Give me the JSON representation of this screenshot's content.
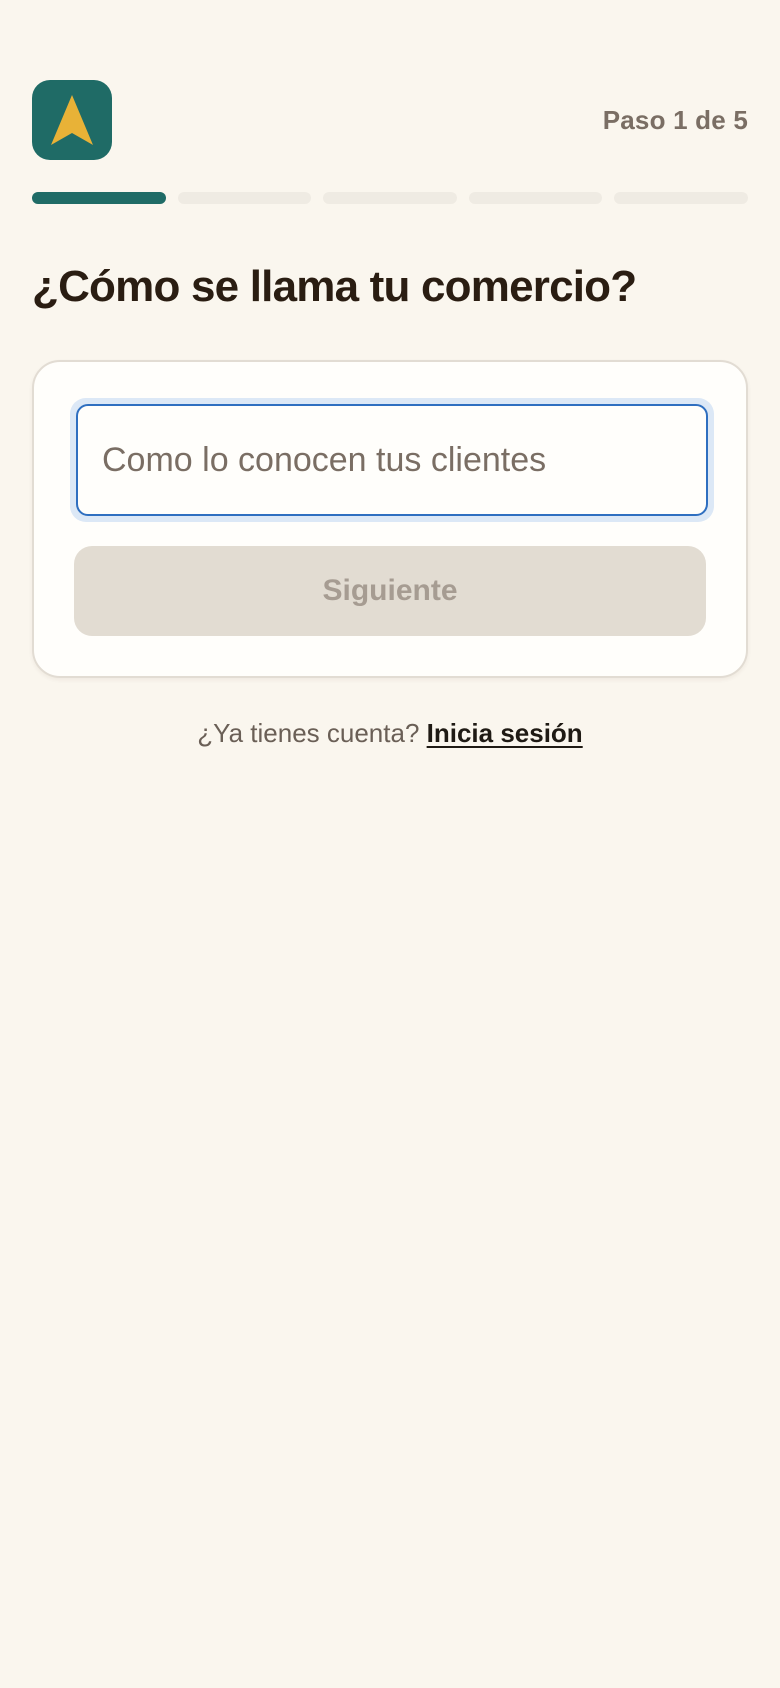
{
  "header": {
    "logo": {
      "icon": "arrow-up-logo-icon",
      "background": "#1F6B66",
      "accent": "#E8B237"
    },
    "step_counter": "Paso 1 de 5"
  },
  "progress": {
    "current_step": 1,
    "total_steps": 5,
    "active_color": "#1F6B66",
    "inactive_color": "#EFEBE3"
  },
  "main": {
    "title": "¿Cómo se llama tu comercio?",
    "business_name_input": {
      "value": "",
      "placeholder": "Como lo conocen tus clientes"
    },
    "next_button_label": "Siguiente",
    "next_button_disabled": true
  },
  "footer": {
    "prompt": "¿Ya tienes cuenta?",
    "login_link": "Inicia sesión"
  }
}
